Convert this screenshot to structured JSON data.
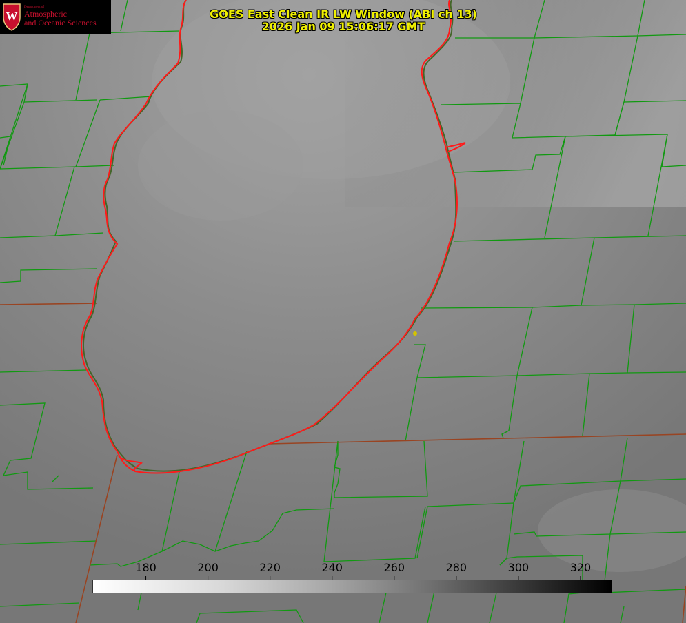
{
  "header": {
    "title_line1": "GOES East Clean IR LW Window (ABI ch 13)",
    "title_line2": "2026 Jan 09 15:06:17 GMT"
  },
  "logo": {
    "department": "Department of",
    "line1": "Atmospheric",
    "line2": "and Oceanic Sciences",
    "seal_letter": "W"
  },
  "colorbar": {
    "ticks": [
      180,
      200,
      220,
      240,
      260,
      280,
      300,
      320
    ],
    "range": [
      163,
      330
    ],
    "colors": {
      "low": "#ffffff",
      "high": "#000000"
    }
  },
  "map": {
    "lake_outline_color": "#ff1a1a",
    "county_line_color": "#119911",
    "state_line_color": "#994422",
    "marker_color": "#d4c400"
  }
}
